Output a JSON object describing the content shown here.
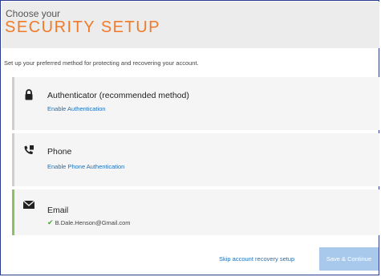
{
  "header": {
    "subtitle": "Choose your",
    "title": "SECURITY SETUP"
  },
  "intro_text": "Set up your preferred method for protecting and recovering your account.",
  "methods": [
    {
      "icon": "lock-icon",
      "title": "Authenticator (recommended method)",
      "action": "Enable Authentication"
    },
    {
      "icon": "phone-icon",
      "title": "Phone",
      "action": "Enable Phone Authentication"
    },
    {
      "icon": "envelope-icon",
      "title": "Email",
      "status_icon": "checkmark-icon",
      "value": "B.Dale.Henson@Gmail.com"
    }
  ],
  "footer": {
    "skip_label": "Skip account recovery setup",
    "save_label": "Save & Continue"
  },
  "colors": {
    "accent_orange": "#f07a2a",
    "link_blue": "#1f6fb8",
    "success_green": "#4fa23a",
    "button_disabled": "#a9c9ec"
  }
}
